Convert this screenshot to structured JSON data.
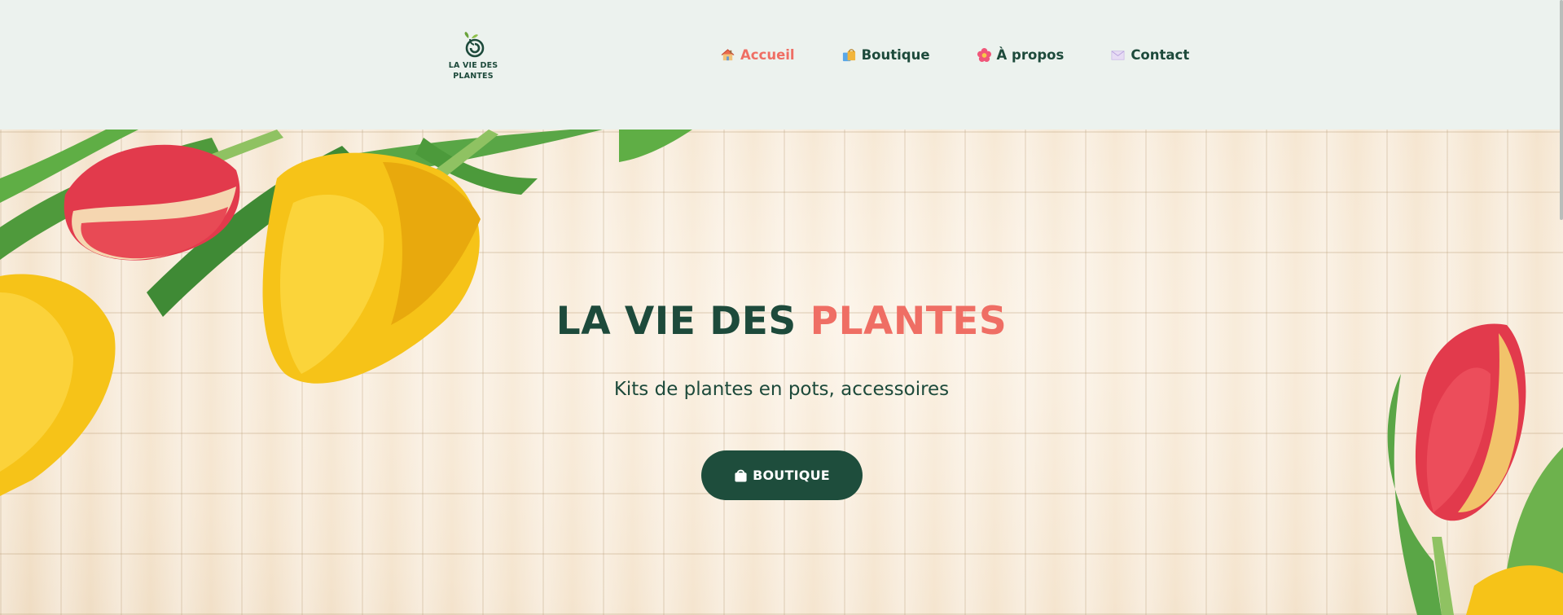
{
  "brand": {
    "logo_line1": "LA VIE DES",
    "logo_line2": "PLANTES"
  },
  "nav": {
    "items": [
      {
        "label": "Accueil",
        "icon": "house-icon",
        "active": true
      },
      {
        "label": "Boutique",
        "icon": "shopping-bags-icon",
        "active": false
      },
      {
        "label": "À propos",
        "icon": "flower-icon",
        "active": false
      },
      {
        "label": "Contact",
        "icon": "envelope-icon",
        "active": false
      }
    ]
  },
  "hero": {
    "title_part1": "LA VIE DES",
    "title_part2": "PLANTES",
    "subtitle": "Kits de plantes en pots, accessoires",
    "button_label": "BOUTIQUE",
    "button_icon": "shopping-bag-icon"
  },
  "colors": {
    "primary_green": "#1d4a3b",
    "accent_coral": "#ef6e64",
    "header_bg": "#ecf2ee",
    "button_bg": "#1e4d3c"
  }
}
